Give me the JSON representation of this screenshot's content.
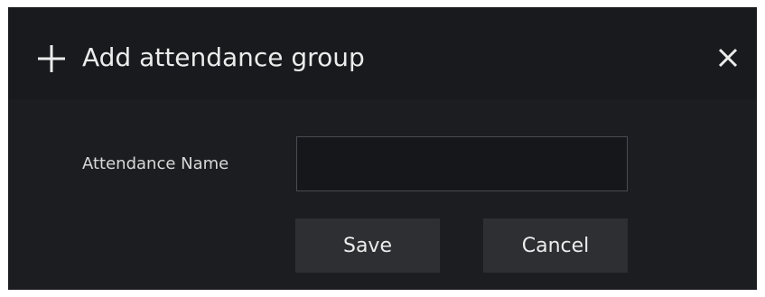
{
  "dialog": {
    "title": "Add attendance group",
    "header_icon": "plus-icon",
    "close_icon": "close-icon"
  },
  "form": {
    "name_label": "Attendance Name",
    "name_value": "",
    "name_placeholder": ""
  },
  "buttons": {
    "save_label": "Save",
    "cancel_label": "Cancel"
  },
  "colors": {
    "dialog_background": "#1c1d21",
    "button_background": "#2e2f33",
    "input_border": "#4a4b50",
    "text": "#ececec"
  }
}
